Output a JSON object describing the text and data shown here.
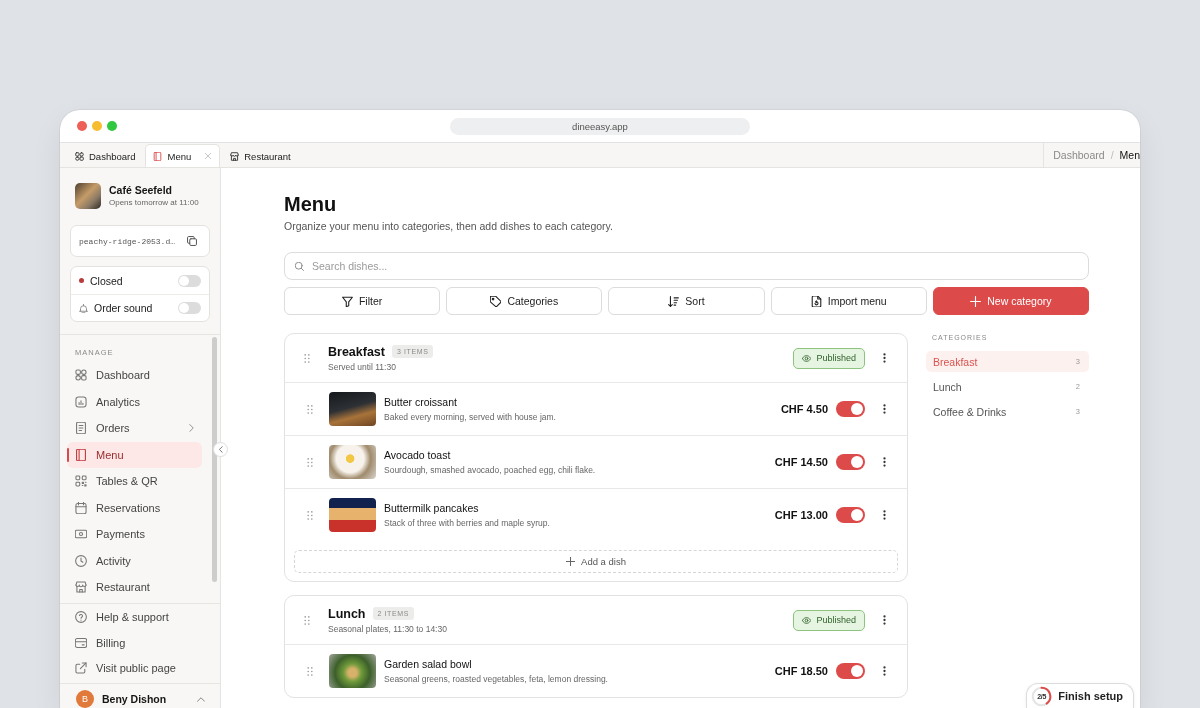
{
  "browser": {
    "url": "dineeasy.app",
    "tabs": [
      {
        "label": "Dashboard",
        "selected": false,
        "closable": false
      },
      {
        "label": "Menu",
        "selected": true,
        "closable": true
      },
      {
        "label": "Restaurant",
        "selected": false,
        "closable": false
      }
    ],
    "breadcrumb": {
      "separator": "/",
      "items": [
        {
          "label": "Dashboard",
          "current": false
        },
        {
          "label": "Men",
          "current": true
        }
      ]
    }
  },
  "sidebar": {
    "venue": {
      "name": "Café Seefeld",
      "status": "Opens tomorrow at 11:00"
    },
    "public_link": "peachy-ridge-2053.d…",
    "switches": [
      {
        "label": "Closed",
        "kind": "status",
        "on": false
      },
      {
        "label": "Order sound",
        "kind": "sound",
        "on": false
      }
    ],
    "section_label": "MANAGE",
    "items": [
      {
        "label": "Dashboard",
        "selected": false,
        "has_submenu": false
      },
      {
        "label": "Analytics",
        "selected": false,
        "has_submenu": false
      },
      {
        "label": "Orders",
        "selected": false,
        "has_submenu": true
      },
      {
        "label": "Menu",
        "selected": true,
        "has_submenu": false
      },
      {
        "label": "Tables & QR",
        "selected": false,
        "has_submenu": false
      },
      {
        "label": "Reservations",
        "selected": false,
        "has_submenu": false
      },
      {
        "label": "Payments",
        "selected": false,
        "has_submenu": false
      },
      {
        "label": "Activity",
        "selected": false,
        "has_submenu": false
      },
      {
        "label": "Restaurant",
        "selected": false,
        "has_submenu": false
      }
    ],
    "footer_items": [
      {
        "label": "Help & support"
      },
      {
        "label": "Billing"
      },
      {
        "label": "Visit public page"
      }
    ],
    "user": {
      "initial": "B",
      "name": "Beny Dishon"
    }
  },
  "page": {
    "title": "Menu",
    "subtitle": "Organize your menu into categories, then add dishes to each category.",
    "search": {
      "placeholder": "Search dishes..."
    },
    "actions": [
      {
        "label": "Filter",
        "primary": false
      },
      {
        "label": "Categories",
        "primary": false
      },
      {
        "label": "Sort",
        "primary": false
      },
      {
        "label": "Import menu",
        "primary": false
      },
      {
        "label": "New category",
        "primary": true
      }
    ]
  },
  "categories": [
    {
      "name": "Breakfast",
      "item_count": "3 ITEMS",
      "note": "Served until 11:30",
      "status": "Published",
      "published": true,
      "dishes": [
        {
          "name": "Butter croissant",
          "description": "Baked every morning, served with house jam.",
          "price": "CHF 4.50",
          "available": true
        },
        {
          "name": "Avocado toast",
          "description": "Sourdough, smashed avocado, poached egg, chili flake.",
          "price": "CHF 14.50",
          "available": true
        },
        {
          "name": "Buttermilk pancakes",
          "description": "Stack of three with berries and maple syrup.",
          "price": "CHF 13.00",
          "available": true
        }
      ],
      "add_label": "Add a dish"
    },
    {
      "name": "Lunch",
      "item_count": "2 ITEMS",
      "note": "Seasonal plates, 11:30 to 14:30",
      "status": "Published",
      "published": true,
      "dishes": [
        {
          "name": "Garden salad bowl",
          "description": "Seasonal greens, roasted vegetables, feta, lemon dressing.",
          "price": "CHF 18.50",
          "available": true
        }
      ]
    }
  ],
  "category_nav": {
    "title": "CATEGORIES",
    "items": [
      {
        "label": "Breakfast",
        "count": "3",
        "selected": true
      },
      {
        "label": "Lunch",
        "count": "2",
        "selected": false
      },
      {
        "label": "Coffee & Drinks",
        "count": "3",
        "selected": false
      }
    ]
  },
  "setup": {
    "progress": "2/5",
    "label": "Finish setup",
    "level": 0.4
  }
}
